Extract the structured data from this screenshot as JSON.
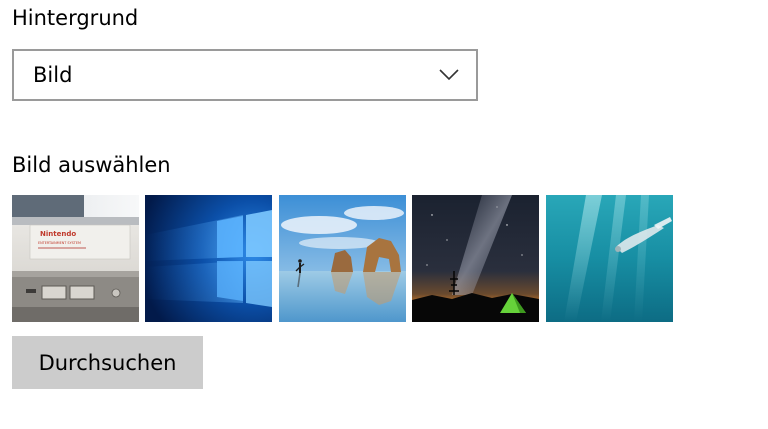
{
  "background": {
    "label": "Hintergrund",
    "selected": "Bild",
    "chevron_icon": "chevron-down-icon"
  },
  "picture_picker": {
    "label": "Bild auswählen",
    "thumbnails": [
      {
        "subject": "nes-console",
        "logo_text": "Nintendo",
        "sub_text": "ENTERTAINMENT SYSTEM"
      },
      {
        "subject": "windows-10-hero"
      },
      {
        "subject": "beach-rock-arch"
      },
      {
        "subject": "night-sky-tent"
      },
      {
        "subject": "underwater-swimmer"
      }
    ],
    "browse_label": "Durchsuchen"
  }
}
